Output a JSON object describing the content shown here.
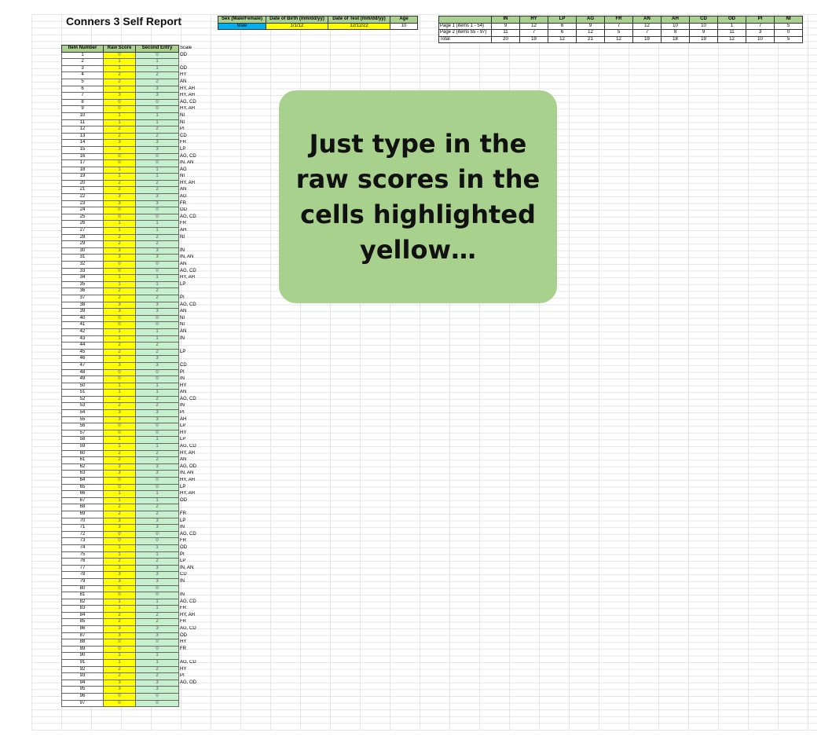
{
  "title": "Conners 3 Self Report",
  "info": {
    "headers": [
      "Sex (Male/Female)",
      "Date of Birth (mm/dd/yy)",
      "Date of Test (mm/dd/yy)",
      "Age"
    ],
    "values": [
      "Male",
      "1/1/12",
      "12/12/22",
      "10"
    ]
  },
  "summary": {
    "scales": [
      "IN",
      "HY",
      "LP",
      "AG",
      "FR",
      "AN",
      "AH",
      "CD",
      "OD",
      "PI",
      "NI"
    ],
    "rows": [
      {
        "label": "Page 1 (items 1 - 54)",
        "values": [
          "9",
          "12",
          "6",
          "9",
          "7",
          "12",
          "10",
          "10",
          "1",
          "7",
          "5"
        ]
      },
      {
        "label": "Page 2 (items 55 - 97)",
        "values": [
          "11",
          "7",
          "6",
          "12",
          "5",
          "7",
          "8",
          "9",
          "11",
          "3",
          "0"
        ]
      },
      {
        "label": "Total",
        "values": [
          "20",
          "19",
          "12",
          "21",
          "12",
          "19",
          "18",
          "19",
          "12",
          "10",
          "5"
        ]
      }
    ]
  },
  "items_table": {
    "headers": [
      "Item Number",
      "Raw Score",
      "Second Entry",
      "Scale"
    ],
    "rows": [
      [
        "1",
        "0",
        "0",
        "OD"
      ],
      [
        "2",
        "1",
        "1",
        ""
      ],
      [
        "3",
        "1",
        "1",
        "OD"
      ],
      [
        "4",
        "2",
        "2",
        "HY"
      ],
      [
        "5",
        "2",
        "2",
        "AN"
      ],
      [
        "6",
        "3",
        "3",
        "HY, AH"
      ],
      [
        "7",
        "3",
        "3",
        "HY, AH"
      ],
      [
        "8",
        "0",
        "0",
        "AG, CD"
      ],
      [
        "9",
        "0",
        "0",
        "HY, AH"
      ],
      [
        "10",
        "1",
        "1",
        "NI"
      ],
      [
        "11",
        "1",
        "1",
        "NI"
      ],
      [
        "12",
        "2",
        "2",
        "PI"
      ],
      [
        "13",
        "2",
        "2",
        "CD"
      ],
      [
        "14",
        "3",
        "3",
        "FR"
      ],
      [
        "15",
        "3",
        "3",
        "LP"
      ],
      [
        "16",
        "0",
        "0",
        "AG, CD"
      ],
      [
        "17",
        "0",
        "0",
        "IN, AN"
      ],
      [
        "18",
        "1",
        "1",
        "AG"
      ],
      [
        "19",
        "1",
        "1",
        "NI"
      ],
      [
        "20",
        "2",
        "2",
        "HY, AH"
      ],
      [
        "21",
        "2",
        "2",
        "AN"
      ],
      [
        "22",
        "3",
        "3",
        "AG"
      ],
      [
        "23",
        "3",
        "3",
        "FR"
      ],
      [
        "24",
        "0",
        "0",
        "OD"
      ],
      [
        "25",
        "0",
        "0",
        "AG, CD"
      ],
      [
        "26",
        "1",
        "1",
        "FR"
      ],
      [
        "27",
        "1",
        "1",
        "AH"
      ],
      [
        "28",
        "2",
        "2",
        "NI"
      ],
      [
        "29",
        "2",
        "2",
        ""
      ],
      [
        "30",
        "3",
        "3",
        "IN"
      ],
      [
        "31",
        "3",
        "3",
        "IN, AN"
      ],
      [
        "32",
        "0",
        "0",
        "AN"
      ],
      [
        "33",
        "0",
        "0",
        "AG, CD"
      ],
      [
        "34",
        "1",
        "1",
        "HY, AH"
      ],
      [
        "35",
        "1",
        "1",
        "LP"
      ],
      [
        "36",
        "2",
        "2",
        ""
      ],
      [
        "37",
        "2",
        "2",
        "PI"
      ],
      [
        "38",
        "3",
        "3",
        "AG, CD"
      ],
      [
        "39",
        "3",
        "3",
        "AN"
      ],
      [
        "40",
        "0",
        "0",
        "NI"
      ],
      [
        "41",
        "0",
        "0",
        "NI"
      ],
      [
        "42",
        "1",
        "1",
        "AN"
      ],
      [
        "43",
        "1",
        "1",
        "IN"
      ],
      [
        "44",
        "2",
        "2",
        ""
      ],
      [
        "45",
        "2",
        "2",
        "LP"
      ],
      [
        "46",
        "3",
        "3",
        ""
      ],
      [
        "47",
        "3",
        "3",
        "CD"
      ],
      [
        "48",
        "0",
        "0",
        "PI"
      ],
      [
        "49",
        "0",
        "0",
        "IN"
      ],
      [
        "50",
        "1",
        "1",
        "HY"
      ],
      [
        "51",
        "1",
        "1",
        "AN"
      ],
      [
        "52",
        "2",
        "2",
        "AG, CD"
      ],
      [
        "53",
        "2",
        "2",
        "IN"
      ],
      [
        "54",
        "3",
        "3",
        "PI"
      ],
      [
        "55",
        "3",
        "3",
        "AH"
      ],
      [
        "56",
        "0",
        "0",
        "LP"
      ],
      [
        "57",
        "0",
        "0",
        "HY"
      ],
      [
        "58",
        "1",
        "1",
        "LP"
      ],
      [
        "59",
        "1",
        "1",
        "AG, CD"
      ],
      [
        "60",
        "2",
        "2",
        "HY, AH"
      ],
      [
        "61",
        "2",
        "2",
        "AN"
      ],
      [
        "62",
        "3",
        "3",
        "AG, OD"
      ],
      [
        "63",
        "3",
        "3",
        "IN, AN"
      ],
      [
        "64",
        "0",
        "0",
        "HY, AH"
      ],
      [
        "65",
        "0",
        "0",
        "LP"
      ],
      [
        "66",
        "1",
        "1",
        "HY, AH"
      ],
      [
        "67",
        "1",
        "1",
        "OD"
      ],
      [
        "68",
        "2",
        "2",
        ""
      ],
      [
        "69",
        "2",
        "2",
        "FR"
      ],
      [
        "70",
        "3",
        "3",
        "LP"
      ],
      [
        "71",
        "3",
        "3",
        "IN"
      ],
      [
        "72",
        "0",
        "0",
        "AG, CD"
      ],
      [
        "73",
        "0",
        "0",
        "FR"
      ],
      [
        "74",
        "1",
        "1",
        "OD"
      ],
      [
        "75",
        "1",
        "1",
        "PI"
      ],
      [
        "76",
        "2",
        "2",
        "LP"
      ],
      [
        "77",
        "3",
        "3",
        "IN, AN"
      ],
      [
        "78",
        "3",
        "3",
        "CD"
      ],
      [
        "79",
        "3",
        "3",
        "IN"
      ],
      [
        "80",
        "0",
        "0",
        ""
      ],
      [
        "81",
        "0",
        "0",
        "IN"
      ],
      [
        "82",
        "1",
        "1",
        "AG, CD"
      ],
      [
        "83",
        "1",
        "1",
        "FR"
      ],
      [
        "84",
        "2",
        "2",
        "HY, AH"
      ],
      [
        "85",
        "2",
        "2",
        "FR"
      ],
      [
        "86",
        "3",
        "3",
        "AG, CD"
      ],
      [
        "87",
        "3",
        "3",
        "OD"
      ],
      [
        "88",
        "0",
        "0",
        "HY"
      ],
      [
        "89",
        "0",
        "0",
        "FR"
      ],
      [
        "90",
        "1",
        "1",
        ""
      ],
      [
        "91",
        "1",
        "1",
        "AG, CD"
      ],
      [
        "92",
        "2",
        "2",
        "HY"
      ],
      [
        "93",
        "2",
        "2",
        "PI"
      ],
      [
        "94",
        "3",
        "3",
        "AG, OD"
      ],
      [
        "95",
        "3",
        "3",
        ""
      ],
      [
        "96",
        "0",
        "0",
        ""
      ],
      [
        "97",
        "0",
        "0",
        ""
      ]
    ]
  },
  "callout": {
    "text": "Just type in the raw scores in the cells highlighted yellow…"
  },
  "colors": {
    "header_green": "#a9d08e",
    "raw_yellow": "#ffff00",
    "second_green": "#c6efce",
    "sex_blue": "#00b0f0",
    "callout_green": "#a9d18e"
  }
}
